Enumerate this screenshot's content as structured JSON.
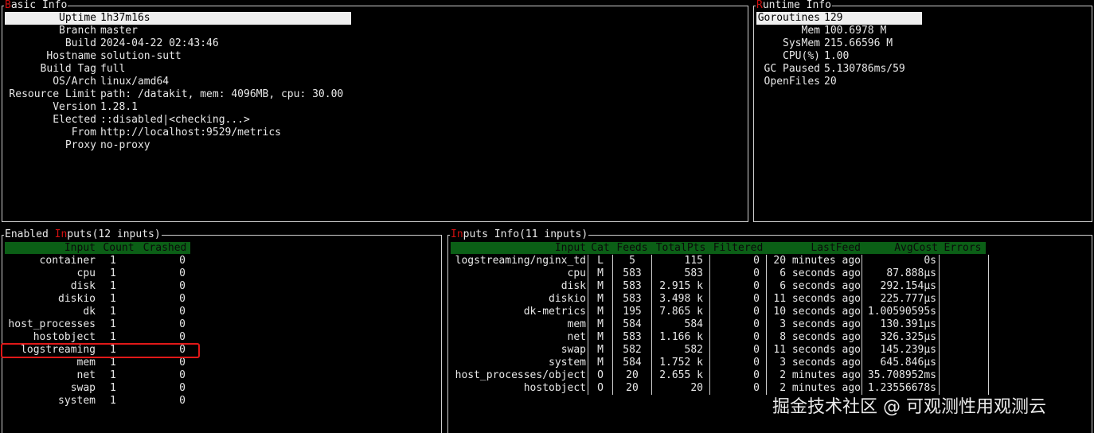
{
  "basic_info": {
    "title_first": "B",
    "title_rest": "asic Info",
    "rows": [
      {
        "label": "Uptime",
        "value": "1h37m16s"
      },
      {
        "label": "Branch",
        "value": "master"
      },
      {
        "label": "Build",
        "value": "2024-04-22 02:43:46"
      },
      {
        "label": "Hostname",
        "value": "solution-sutt"
      },
      {
        "label": "Build Tag",
        "value": "full"
      },
      {
        "label": "OS/Arch",
        "value": "linux/amd64"
      },
      {
        "label": "Resource Limit",
        "value": "path: /datakit, mem: 4096MB, cpu: 30.00"
      },
      {
        "label": "Version",
        "value": "1.28.1"
      },
      {
        "label": "Elected",
        "value": "::disabled|<checking...>"
      },
      {
        "label": "From",
        "value": "http://localhost:9529/metrics"
      },
      {
        "label": "Proxy",
        "value": "no-proxy"
      }
    ]
  },
  "runtime_info": {
    "title_first": "R",
    "title_rest": "untime Info",
    "rows": [
      {
        "label": "Goroutines",
        "value": "129"
      },
      {
        "label": "Mem",
        "value": "100.6978 M"
      },
      {
        "label": "SysMem",
        "value": "215.66596 M"
      },
      {
        "label": "CPU(%)",
        "value": "1.00"
      },
      {
        "label": "GC Paused",
        "value": "5.130786ms/59"
      },
      {
        "label": "OpenFiles",
        "value": "20"
      }
    ]
  },
  "enabled_inputs": {
    "title_pre": "Enabled ",
    "title_hl": "In",
    "title_post": "puts(12 inputs)",
    "columns": [
      "Input",
      "Count",
      "Crashed"
    ],
    "rows": [
      [
        "container",
        "1",
        "0"
      ],
      [
        "cpu",
        "1",
        "0"
      ],
      [
        "disk",
        "1",
        "0"
      ],
      [
        "diskio",
        "1",
        "0"
      ],
      [
        "dk",
        "1",
        "0"
      ],
      [
        "host_processes",
        "1",
        "0"
      ],
      [
        "hostobject",
        "1",
        "0"
      ],
      [
        "logstreaming",
        "1",
        "0"
      ],
      [
        "mem",
        "1",
        "0"
      ],
      [
        "net",
        "1",
        "0"
      ],
      [
        "swap",
        "1",
        "0"
      ],
      [
        "system",
        "1",
        "0"
      ]
    ]
  },
  "inputs_info": {
    "title_hl": "In",
    "title_post": "puts Info(11 inputs)",
    "columns": [
      "Input",
      "Cat",
      "Feeds",
      "TotalPts",
      "Filtered",
      "LastFeed",
      "AvgCost",
      "Errors"
    ],
    "rows": [
      [
        "logstreaming/nginx_td",
        "L",
        "5",
        "115",
        "0",
        "20 minutes ago",
        "0s",
        ""
      ],
      [
        "cpu",
        "M",
        "583",
        "583",
        "0",
        "6 seconds ago",
        "87.888µs",
        ""
      ],
      [
        "disk",
        "M",
        "583",
        "2.915 k",
        "0",
        "6 seconds ago",
        "292.154µs",
        ""
      ],
      [
        "diskio",
        "M",
        "583",
        "3.498 k",
        "0",
        "11 seconds ago",
        "225.777µs",
        ""
      ],
      [
        "dk-metrics",
        "M",
        "195",
        "7.865 k",
        "0",
        "10 seconds ago",
        "1.00590595s",
        ""
      ],
      [
        "mem",
        "M",
        "584",
        "584",
        "0",
        "3 seconds ago",
        "130.391µs",
        ""
      ],
      [
        "net",
        "M",
        "583",
        "1.166 k",
        "0",
        "8 seconds ago",
        "326.325µs",
        ""
      ],
      [
        "swap",
        "M",
        "582",
        "582",
        "0",
        "11 seconds ago",
        "145.239µs",
        ""
      ],
      [
        "system",
        "M",
        "584",
        "1.752 k",
        "0",
        "3 seconds ago",
        "645.846µs",
        ""
      ],
      [
        "host_processes/object",
        "O",
        "20",
        "2.655 k",
        "0",
        "2 minutes ago",
        "35.708952ms",
        ""
      ],
      [
        "hostobject",
        "O",
        "20",
        "20",
        "0",
        "2 minutes ago",
        "1.23556678s",
        ""
      ]
    ]
  },
  "watermark": "掘金技术社区 @ 可观测性用观测云",
  "colors": {
    "header_bg": "#0b5f16",
    "highlight": "#d01010",
    "selection": "#efefef",
    "annotation": "#e01818"
  }
}
